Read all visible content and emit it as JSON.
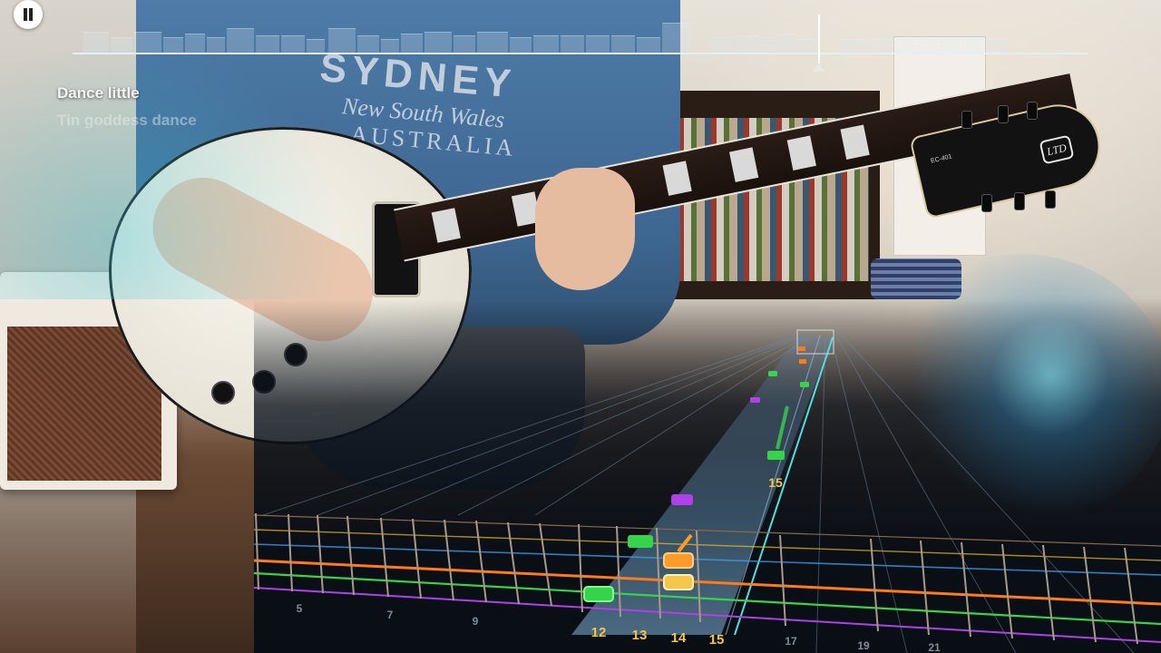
{
  "lyrics": {
    "current": "Dance little",
    "next": "Tin goddess dance"
  },
  "shirt": {
    "line1": "SYDNEY",
    "line2": "New South Wales",
    "line3": "AUSTRALIA"
  },
  "headstock": {
    "logo": "LTD",
    "model": "EC-401"
  },
  "controls": {
    "pause_icon": "pause-icon"
  },
  "progress": {
    "position_fraction": 0.736
  },
  "highway": {
    "string_colors": [
      "#e0446a",
      "#f0c020",
      "#3c9ae8",
      "#ff7a1a",
      "#36d44a",
      "#b040e8"
    ],
    "fret_labels": [
      "5",
      "7",
      "9",
      "12",
      "13",
      "14",
      "15",
      "17",
      "19",
      "21"
    ],
    "note_fret_label": "15",
    "lane_numbers": [
      "12",
      "13",
      "14",
      "15"
    ],
    "dim_numbers": [
      "5",
      "7",
      "9",
      "17",
      "19",
      "21"
    ]
  },
  "colors": {
    "accent_yellow": "#f5c64a",
    "string_orange": "#ff7a1a",
    "string_green": "#36d44a",
    "string_purple": "#b040e8"
  }
}
